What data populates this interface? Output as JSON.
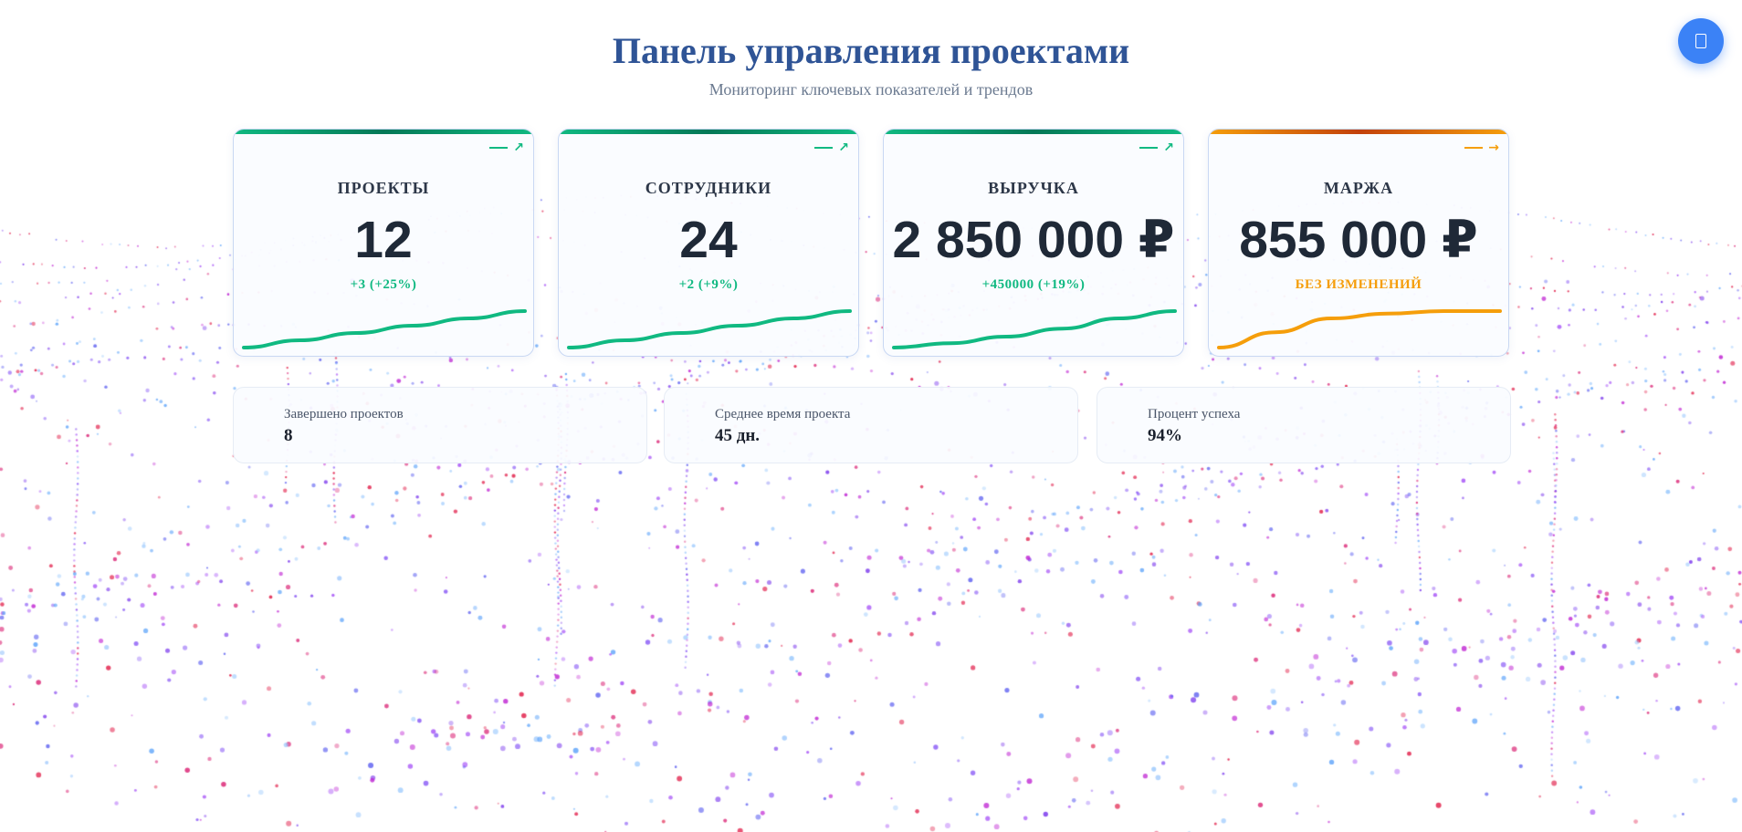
{
  "header": {
    "title": "Панель управления проектами",
    "subtitle": "Мониторинг ключевых показателей и трендов"
  },
  "fab": {
    "icon": "document-icon"
  },
  "colors": {
    "title": "#2f5496",
    "positive": "#10b981",
    "neutral": "#f59e0b",
    "accent": "#3b82f6"
  },
  "cards": [
    {
      "label": "ПРОЕКТЫ",
      "value": "12",
      "change": "+3 (+25%)",
      "trend_icon": "↗",
      "status": "positive",
      "spark": [
        0.0,
        0.2,
        0.4,
        0.6,
        0.8,
        1.0
      ]
    },
    {
      "label": "СОТРУДНИКИ",
      "value": "24",
      "change": "+2 (+9%)",
      "trend_icon": "↗",
      "status": "positive",
      "spark": [
        0.0,
        0.2,
        0.4,
        0.6,
        0.8,
        1.0
      ]
    },
    {
      "label": "ВЫРУЧКА",
      "value": "2 850 000 ₽",
      "change": "+450000 (+19%)",
      "trend_icon": "↗",
      "status": "positive",
      "spark": [
        0.0,
        0.12,
        0.3,
        0.52,
        0.8,
        1.0
      ]
    },
    {
      "label": "МАРЖА",
      "value": "855 000 ₽",
      "change": "БЕЗ ИЗМЕНЕНИЙ",
      "trend_icon": "→",
      "status": "neutral",
      "spark": [
        0.0,
        0.42,
        0.8,
        0.93,
        1.0,
        1.0
      ]
    }
  ],
  "stats": [
    {
      "label": "Завершено проектов",
      "value": "8"
    },
    {
      "label": "Среднее время проекта",
      "value": "45 дн."
    },
    {
      "label": "Процент успеха",
      "value": "94%"
    }
  ]
}
